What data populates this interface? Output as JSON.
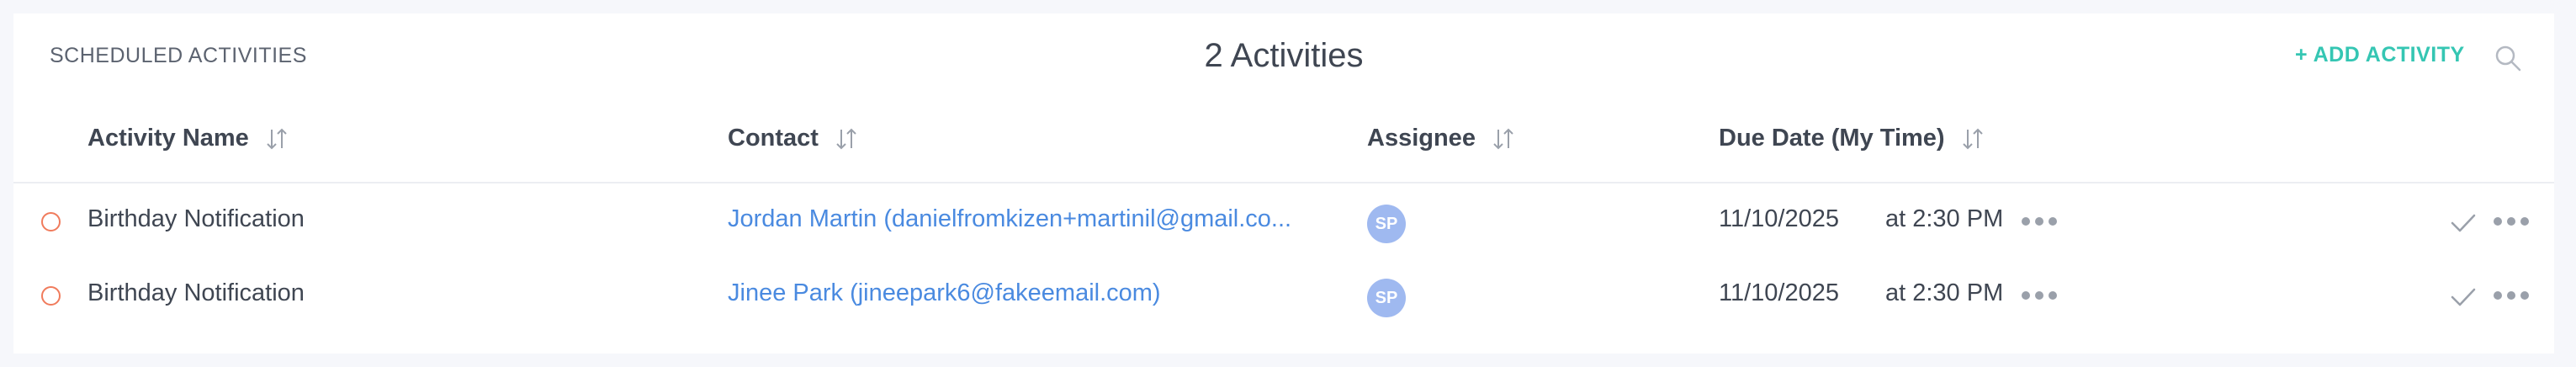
{
  "header": {
    "section_title": "SCHEDULED ACTIVITIES",
    "count_title": "2 Activities",
    "add_button_label": "+ ADD ACTIVITY",
    "search_icon": "search-icon"
  },
  "columns": [
    {
      "label": "Activity Name",
      "sort_icon": "sort-icon"
    },
    {
      "label": "Contact",
      "sort_icon": "sort-icon"
    },
    {
      "label": "Assignee",
      "sort_icon": "sort-icon"
    },
    {
      "label": "Due Date (My Time)",
      "sort_icon": "sort-icon"
    }
  ],
  "rows": [
    {
      "activity": "Birthday Notification",
      "contact": "Jordan Martin (danielfromkizen+martinil@gmail.co...",
      "assignee_initials": "SP",
      "due_date": "11/10/2025",
      "due_time": "at 2:30 PM"
    },
    {
      "activity": "Birthday Notification",
      "contact": "Jinee Park (jineepark6@fakeemail.com)",
      "assignee_initials": "SP",
      "due_date": "11/10/2025",
      "due_time": "at 2:30 PM"
    }
  ],
  "colors": {
    "accent": "#35c6b3",
    "link": "#4a8ae0",
    "status_ring": "#f07b5c",
    "avatar_bg": "#9fb9f0"
  }
}
